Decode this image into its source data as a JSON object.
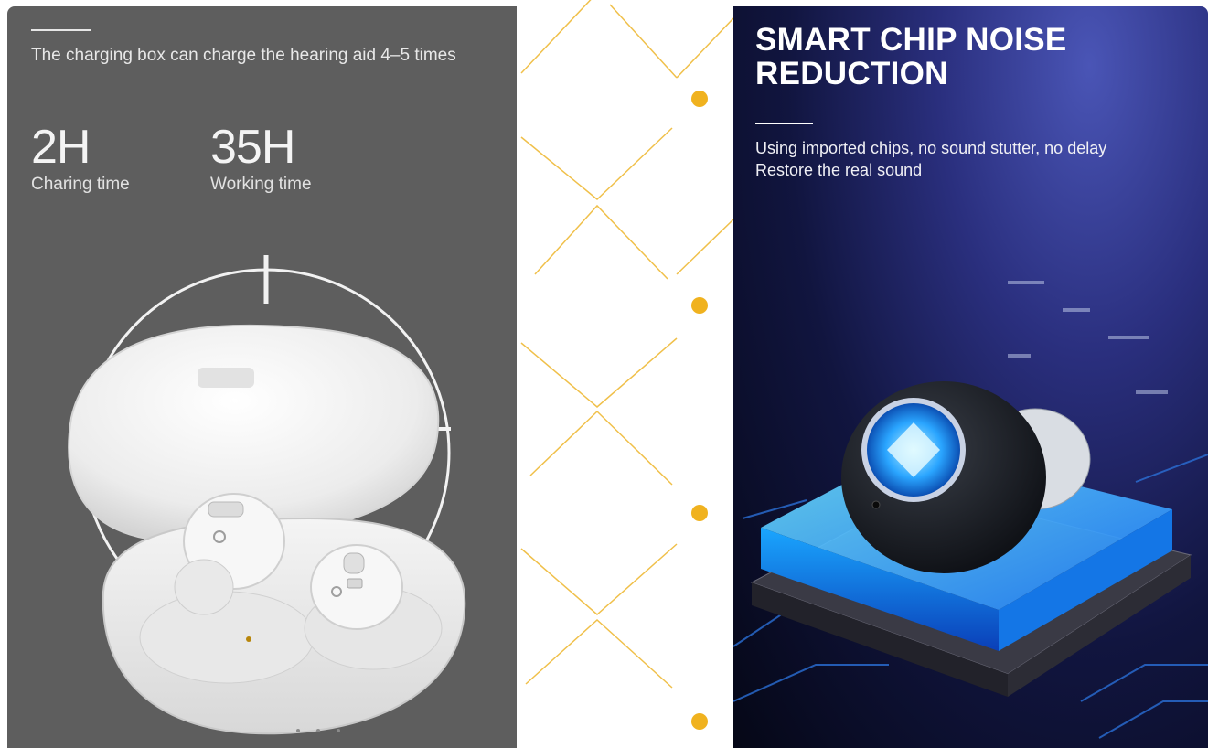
{
  "left_panel": {
    "caption": "The charging box can charge the hearing aid 4–5 times",
    "stats": [
      {
        "value": "2H",
        "label": "Charing time"
      },
      {
        "value": "35H",
        "label": "Working time"
      }
    ]
  },
  "right_panel": {
    "title": "SMART CHIP NOISE REDUCTION",
    "description_line1": "Using imported chips, no sound stutter, no delay",
    "description_line2": "Restore the real sound"
  },
  "colors": {
    "left_background": "#5e5e5e",
    "accent_dot": "#f0b21f",
    "right_background": "#11153f",
    "chip_glow": "#1fa8ff"
  }
}
